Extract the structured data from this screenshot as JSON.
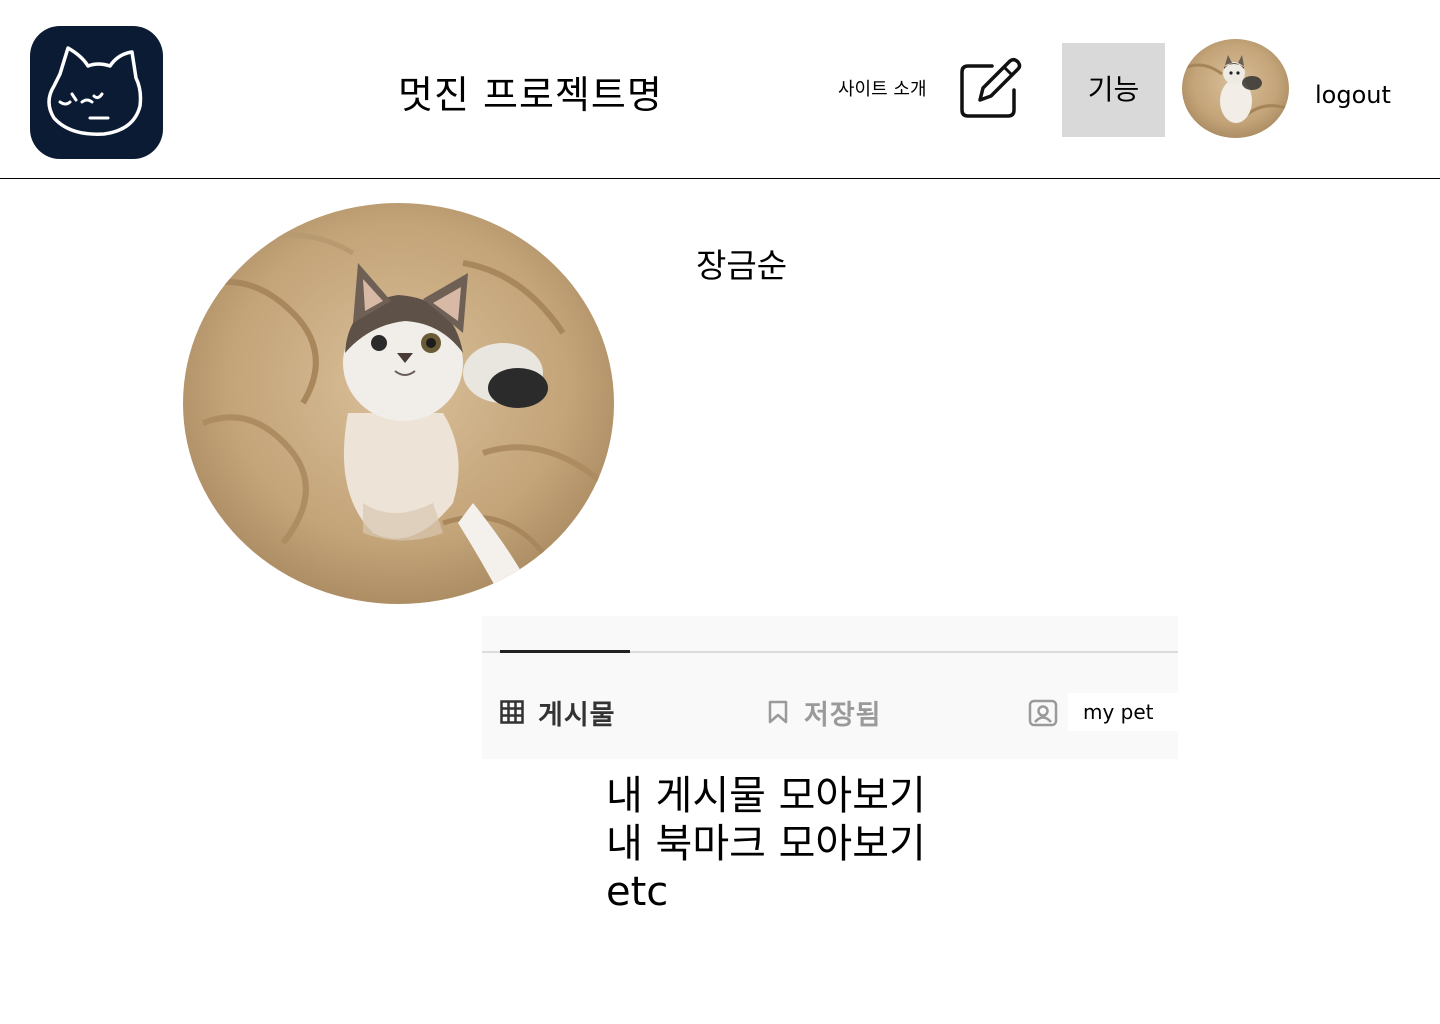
{
  "header": {
    "site_title": "멋진 프로젝트명",
    "nav_about": "사이트 소개",
    "feature_button": "기능",
    "logout": "logout",
    "icons": {
      "logo": "cat-logo-icon",
      "edit": "pencil-square-icon",
      "avatar": "cat-avatar"
    }
  },
  "profile": {
    "name": "장금순",
    "photo": "cat-photo"
  },
  "tabs": {
    "items": [
      {
        "label": "게시물",
        "icon": "grid-icon",
        "active": true
      },
      {
        "label": "저장됨",
        "icon": "bookmark-icon",
        "active": false
      },
      {
        "label": "my pet",
        "icon": "contact-icon",
        "active": false
      }
    ]
  },
  "content": {
    "lines": [
      "내 게시물 모아보기",
      "내 북마크 모아보기",
      "etc"
    ]
  },
  "colors": {
    "logo_bg": "#0b1b33",
    "feature_bg": "#d9d9d9",
    "tabs_bg": "#f9f9f9",
    "active_tab_indicator": "#222222"
  }
}
